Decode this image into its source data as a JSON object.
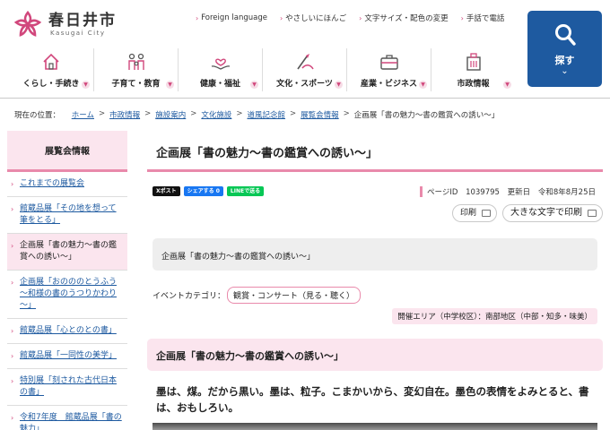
{
  "site": {
    "name": "春日井市",
    "subtitle": "Kasugai City"
  },
  "util_nav": [
    "Foreign language",
    "やさしいにほんご",
    "文字サイズ・配色の変更",
    "手話で電話"
  ],
  "search": {
    "label": "探す"
  },
  "main_nav": [
    {
      "label": "くらし・手続き",
      "icon": "house-icon"
    },
    {
      "label": "子育て・教育",
      "icon": "family-icon"
    },
    {
      "label": "健康・福祉",
      "icon": "care-hands-icon"
    },
    {
      "label": "文化・スポーツ",
      "icon": "sports-icon"
    },
    {
      "label": "産業・ビジネス",
      "icon": "briefcase-icon"
    },
    {
      "label": "市政情報",
      "icon": "city-hall-icon"
    }
  ],
  "breadcrumb": {
    "prefix": "現在の位置：",
    "links": [
      "ホーム",
      "市政情報",
      "施設案内",
      "文化施設",
      "道風記念館",
      "展覧会情報"
    ],
    "current": "企画展「書の魅力～書の鑑賞への誘い～」"
  },
  "sidebar": {
    "title": "展覧会情報",
    "items": [
      {
        "label": "これまでの展覧会",
        "current": false
      },
      {
        "label": "館蔵品展「その地を想って筆をとる」",
        "current": false
      },
      {
        "label": "企画展「書の魅力～書の鑑賞への誘い～」",
        "current": true
      },
      {
        "label": "企画展「おのののとうふう～和様の書のうつりかわり～」",
        "current": false
      },
      {
        "label": "館蔵品展「心とのとの書」",
        "current": false
      },
      {
        "label": "館蔵品展「一同性の美学」",
        "current": false
      },
      {
        "label": "特別展「刻された古代日本の書」",
        "current": false
      },
      {
        "label": "令和7年度　館蔵品展「書の魅力」",
        "current": false
      }
    ]
  },
  "page": {
    "title": "企画展「書の魅力～書の鑑賞への誘い～」",
    "social": {
      "x": "Xポスト",
      "facebook": "シェアする 0",
      "line": "LINEで送る"
    },
    "page_id_label": "ページID",
    "page_id": "1039795",
    "updated_label": "更新日",
    "updated": "令和8年8月25日",
    "print_label": "印刷",
    "large_print_label": "大きな文字で印刷",
    "summary": "企画展「書の魅力～書の鑑賞への誘い～」",
    "category_label": "イベントカテゴリ：",
    "category": "観賞・コンサート（見る・聴く）",
    "area": "開催エリア（中学校区）：南部地区（中部・知多・味美）",
    "section_title": "企画展「書の魅力～書の鑑賞への誘い～」",
    "lead": "墨は、煤。だから黒い。墨は、粒子。こまかいから、変幻自在。墨色の表情をよみとると、書は、おもしろい。"
  },
  "colors": {
    "accent_pink": "#e98aab",
    "brand_blue": "#1e5aa0",
    "pink_bg": "#fbe5ee"
  }
}
